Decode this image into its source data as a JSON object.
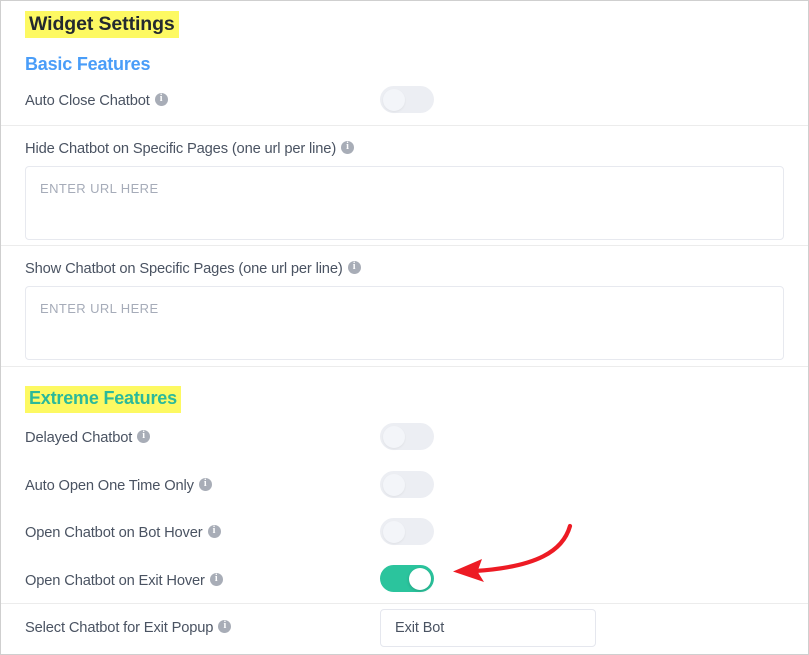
{
  "page": {
    "title": "Widget Settings",
    "sections": [
      {
        "id": "basic",
        "label": "Basic Features"
      },
      {
        "id": "extreme",
        "label": "Extreme Features"
      }
    ]
  },
  "colors": {
    "highlight": "#fdf962",
    "basic_heading": "#4a9df8",
    "extreme_heading": "#2bb99a",
    "toggle_on": "#2bc49d",
    "toggle_off": "#eceef3",
    "label_text": "#4a5362",
    "annotation_arrow": "#ed1b24"
  },
  "basic": {
    "auto_close": {
      "label": "Auto Close Chatbot",
      "info_icon": "info-icon",
      "toggle_state": "off"
    },
    "hide_pages": {
      "label": "Hide Chatbot on Specific Pages (one url per line)",
      "info_icon": "info-icon",
      "placeholder": "ENTER URL HERE",
      "value": ""
    },
    "show_pages": {
      "label": "Show Chatbot on Specific Pages (one url per line)",
      "info_icon": "info-icon",
      "placeholder": "ENTER URL HERE",
      "value": ""
    }
  },
  "extreme": {
    "delayed_chatbot": {
      "label": "Delayed Chatbot",
      "info_icon": "info-icon",
      "toggle_state": "off"
    },
    "auto_open_one_time": {
      "label": "Auto Open One Time Only",
      "info_icon": "info-icon",
      "toggle_state": "off"
    },
    "open_on_bot_hover": {
      "label": "Open Chatbot on Bot Hover",
      "info_icon": "info-icon",
      "toggle_state": "off"
    },
    "open_on_exit_hover": {
      "label": "Open Chatbot on Exit Hover",
      "info_icon": "info-icon",
      "toggle_state": "on"
    },
    "exit_popup_select": {
      "label": "Select Chatbot for Exit Popup",
      "info_icon": "info-icon",
      "selected": "Exit Bot",
      "arrow_icon": "chevron-down-icon"
    }
  }
}
